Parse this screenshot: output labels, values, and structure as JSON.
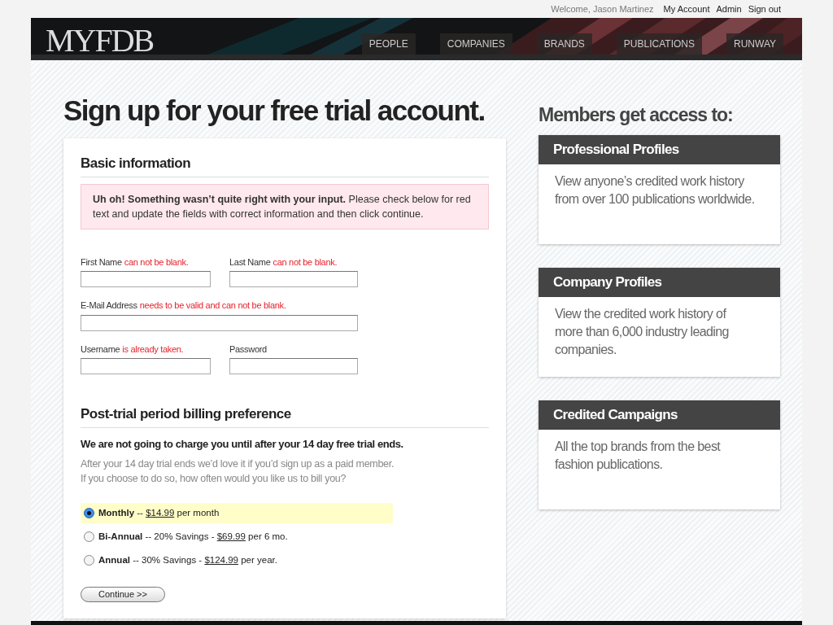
{
  "top_links": {
    "welcome": "Welcome, Jason Martinez",
    "links": [
      "My Account",
      "Admin",
      "Sign out"
    ]
  },
  "header": {
    "logo": "MYFDB",
    "nav": [
      {
        "label": "PEOPLE",
        "selected": false
      },
      {
        "label": "COMPANIES",
        "selected": false
      },
      {
        "label": "BRANDS",
        "selected": false
      },
      {
        "label": "PUBLICATIONS",
        "selected": false
      },
      {
        "label": "RUNWAY",
        "selected": false
      }
    ]
  },
  "page_title": "Sign up for your free trial account.",
  "basic_info": {
    "heading": "Basic information",
    "alert": "**Uh oh! Something wasn’t quite right with your input.** Please check below for red text and update the fields with correct information and then click continue.",
    "fields": [
      {
        "label": "First Name",
        "error": "can not be blank.",
        "kind": "half"
      },
      {
        "label": "Last Name",
        "error": "can not be blank.",
        "kind": "half"
      },
      {
        "label": "E-Mail Address",
        "error": "needs to be valid and can not be blank.",
        "kind": "full"
      },
      {
        "label": "Username",
        "error": "is already taken.",
        "kind": "half"
      },
      {
        "label": "Password",
        "kind": "half"
      }
    ]
  },
  "billing": {
    "heading": "Post-trial period billing preference",
    "lead": "We are not going to charge you until after your 14 day free trial ends.",
    "note": [
      "After your 14 day trial ends we’d love it if you’d sign up as a paid member.",
      "If you choose to do so, how often would you like us to bill you?"
    ],
    "options": [
      {
        "name": "Monthly",
        "detail": " -- ",
        "price": "$14.99",
        "suffix": " per month",
        "selected": true
      },
      {
        "name": "Bi-Annual",
        "detail": " -- 20% Savings - ",
        "price": "$69.99",
        "suffix": " per 6 mo.",
        "selected": false
      },
      {
        "name": "Annual",
        "detail": " -- 30% Savings - ",
        "price": "$124.99",
        "suffix": " per year.",
        "selected": false
      }
    ],
    "button": "Continue >>"
  },
  "members": {
    "heading": "Members get access to:",
    "cards": [
      {
        "title": "Professional Profiles",
        "text": "View anyone’s credited work history from over 100 publications worldwide."
      },
      {
        "title": "Company Profiles",
        "text": "View the credited work history of more than 6,000 industry leading companies."
      },
      {
        "title": "Credited Campaigns",
        "text": "All the top brands from the best fashion publications."
      }
    ]
  }
}
